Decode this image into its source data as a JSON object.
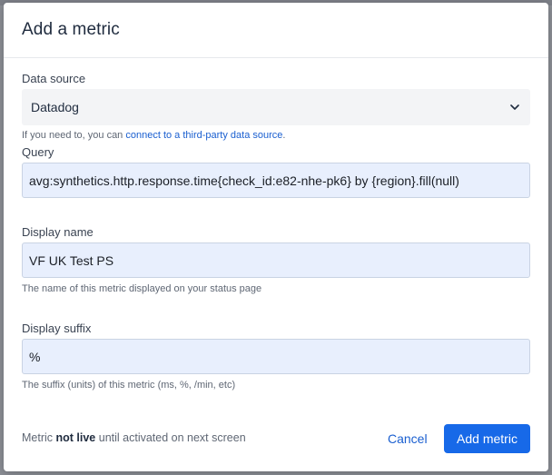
{
  "modal": {
    "title": "Add a metric"
  },
  "data_source": {
    "label": "Data source",
    "selected": "Datadog",
    "help_prefix": "If you need to, you can ",
    "help_link": "connect to a third-party data source",
    "help_suffix": "."
  },
  "query": {
    "label": "Query",
    "value": "avg:synthetics.http.response.time{check_id:e82-nhe-pk6} by {region}.fill(null)"
  },
  "display_name": {
    "label": "Display name",
    "value": "VF UK Test PS",
    "help": "The name of this metric displayed on your status page"
  },
  "display_suffix": {
    "label": "Display suffix",
    "value": "%",
    "help": "The suffix (units) of this metric (ms, %, /min, etc)"
  },
  "footer": {
    "note_prefix": "Metric ",
    "note_bold": "not live",
    "note_suffix": " until activated on next screen",
    "cancel_label": "Cancel",
    "add_label": "Add metric"
  },
  "icons": {
    "select_chevron": "chevron-down-icon"
  },
  "colors": {
    "primary": "#1769e8",
    "link": "#1a5fd0",
    "input_bg": "#e8effd"
  }
}
